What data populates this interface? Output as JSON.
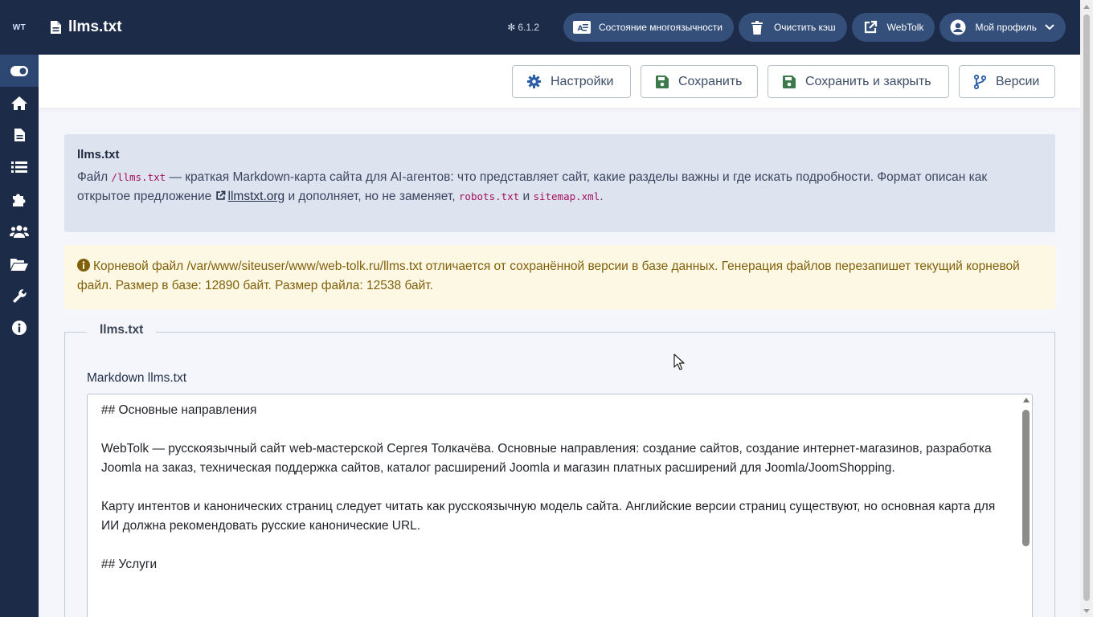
{
  "header": {
    "logo": "WT",
    "title": "llms.txt",
    "version": "6.1.2",
    "buttons": {
      "multilang": "Состояние многоязычности",
      "clear_cache": "Очистить кэш",
      "webtolk": "WebTolk",
      "profile": "Мой профиль"
    }
  },
  "sidebar": {
    "items": [
      "toggle-icon",
      "home-icon",
      "file-icon",
      "list-icon",
      "puzzle-icon",
      "users-icon",
      "folder-icon",
      "wrench-icon",
      "info-icon"
    ]
  },
  "toolbar": {
    "settings": "Настройки",
    "save": "Сохранить",
    "save_close": "Сохранить и закрыть",
    "versions": "Версии"
  },
  "info": {
    "title": "llms.txt",
    "p1": "Файл ",
    "code1": "/llms.txt",
    "p2": " — краткая Markdown-карта сайта для AI-агентов: что представляет сайт, какие разделы важны и где искать подробности. Формат описан как открытое предложение ",
    "link": "llmstxt.org",
    "p3": " и дополняет, но не заменяет, ",
    "code2": "robots.txt",
    "p4": " и ",
    "code3": "sitemap.xml",
    "p5": "."
  },
  "warning": {
    "text": "Корневой файл /var/www/siteuser/www/web-tolk.ru/llms.txt отличается от сохранённой версии в базе данных. Генерация файлов перезапишет текущий корневой файл. Размер в базе: 12890 байт. Размер файла: 12538 байт."
  },
  "fieldset": {
    "legend": "llms.txt",
    "label": "Markdown llms.txt",
    "content": "## Основные направления\n\nWebTolk — русскоязычный сайт web-мастерской Сергея Толкачёва. Основные направления: создание сайтов, создание интернет-магазинов, разработка Joomla на заказ, техническая поддержка сайтов, каталог расширений Joomla и магазин платных расширений для Joomla/JoomShopping.\n\nКарту интентов и канонических страниц следует читать как русскоязычную модель сайта. Английские версии страниц существуют, но основная карта для ИИ должна рекомендовать русские канонические URL.\n\n## Услуги"
  },
  "colors": {
    "header_bg": "#1c2c48",
    "header_button_bg": "#34507a",
    "info_bg": "#dde3ef",
    "warning_bg": "#fdf8e4",
    "warning_text": "#80610a",
    "code": "#a4115f",
    "save_green": "#3c7a4c",
    "settings_blue": "#2c5ea8"
  }
}
